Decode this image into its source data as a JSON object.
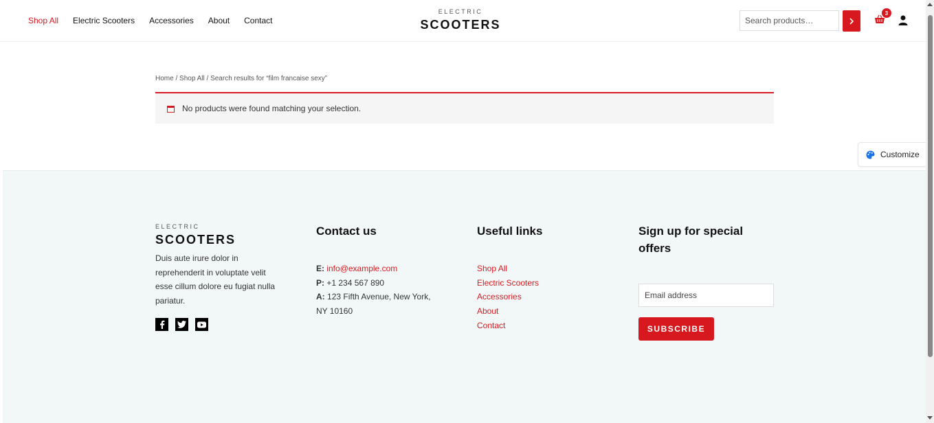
{
  "header": {
    "nav": [
      "Shop All",
      "Electric Scooters",
      "Accessories",
      "About",
      "Contact"
    ],
    "logo_top": "ELECTRIC",
    "logo_main": "SCOOTERS",
    "search_placeholder": "Search products…",
    "cart_count": "3",
    "accent_color": "#d7191f"
  },
  "breadcrumb": {
    "home": "Home",
    "sep": " / ",
    "shop": "Shop All",
    "current": "Search results for “film francaise sexy”"
  },
  "notice": {
    "text": "No products were found matching your selection."
  },
  "customize": {
    "label": "Customize"
  },
  "footer": {
    "logo_top": "ELECTRIC",
    "logo_main": "SCOOTERS",
    "about": "Duis aute irure dolor in reprehenderit in voluptate velit esse cillum dolore eu fugiat nulla pariatur.",
    "contact_title": "Contact us",
    "email_label": "E:",
    "email": "info@example.com",
    "phone_label": "P:",
    "phone": "+1 234 567 890",
    "address_label": "A:",
    "address": "123 Fifth Avenue, New York, NY 10160",
    "links_title": "Useful links",
    "links": [
      "Shop All",
      "Electric Scooters",
      "Accessories",
      "About",
      "Contact"
    ],
    "signup_title": "Sign up for special offers",
    "email_placeholder": "Email address",
    "subscribe_label": "SUBSCRIBE",
    "socials": [
      "facebook-icon",
      "twitter-icon",
      "youtube-icon"
    ],
    "background_color": "#f2f8f8"
  }
}
